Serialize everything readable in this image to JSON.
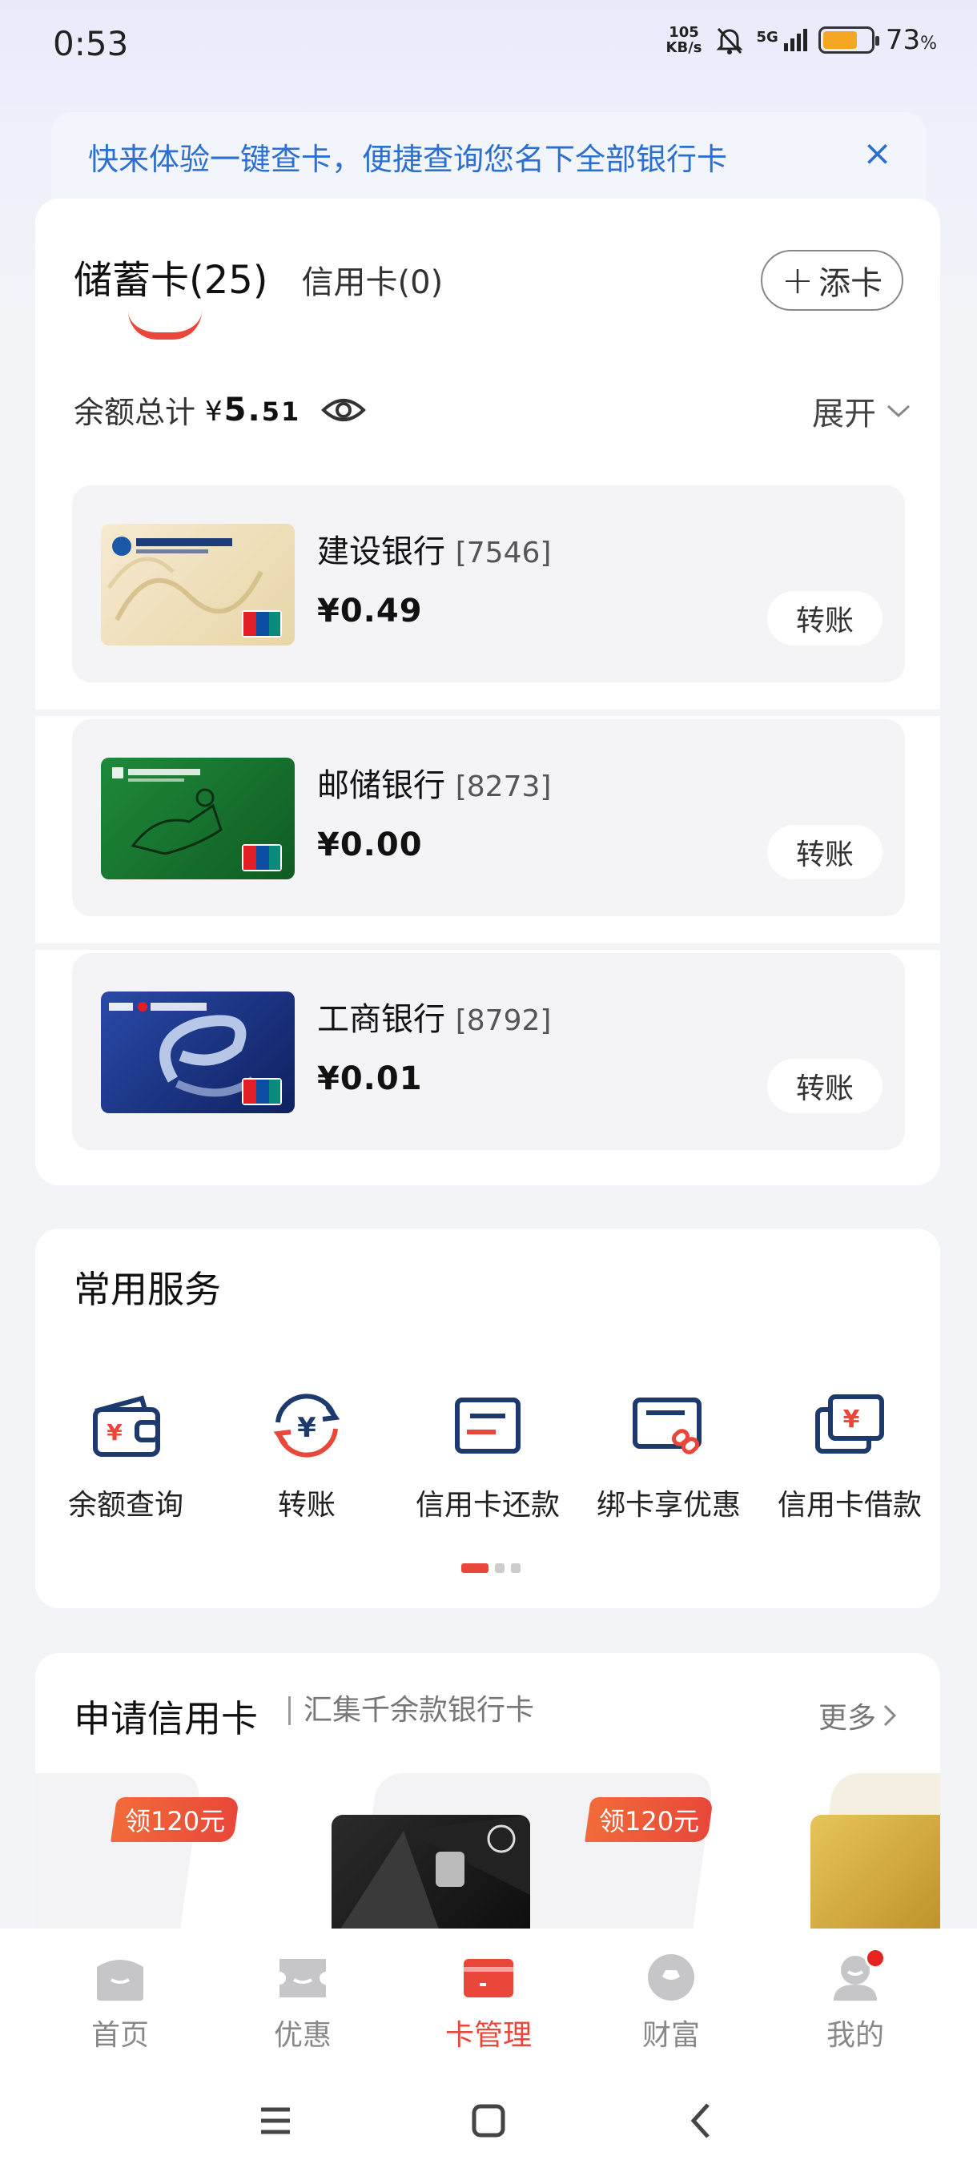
{
  "status_bar": {
    "time": "0:53",
    "net_speed_value": "105",
    "net_speed_unit": "KB/s",
    "network": "5G",
    "battery_percent": "73",
    "battery_unit": "%",
    "battery_level": 0.73
  },
  "banner": {
    "text": "快来体验一键查卡，便捷查询您名下全部银行卡",
    "close_icon": "×"
  },
  "card_tabs": {
    "debit_label": "储蓄卡(25)",
    "credit_label": "信用卡(0)",
    "add_card_label": "添卡"
  },
  "balance": {
    "label": "余额总计",
    "currency": "¥",
    "amount_int": "5.",
    "amount_dec": "51",
    "expand_label": "展开"
  },
  "cards": [
    {
      "bank": "建设银行",
      "number": "[7546]",
      "balance": "¥0.49",
      "transfer_label": "转账"
    },
    {
      "bank": "邮储银行",
      "number": "[8273]",
      "balance": "¥0.00",
      "transfer_label": "转账"
    },
    {
      "bank": "工商银行",
      "number": "[8792]",
      "balance": "¥0.01",
      "transfer_label": "转账"
    }
  ],
  "services": {
    "title": "常用服务",
    "items": [
      {
        "label": "余额查询",
        "icon": "wallet-icon"
      },
      {
        "label": "转账",
        "icon": "transfer-icon"
      },
      {
        "label": "信用卡还款",
        "icon": "card-repay-icon"
      },
      {
        "label": "绑卡享优惠",
        "icon": "bind-card-icon"
      },
      {
        "label": "信用卡借款",
        "icon": "card-loan-icon"
      }
    ]
  },
  "apply": {
    "title": "申请信用卡",
    "subtitle": "汇集千余款银行卡",
    "more_label": "更多",
    "promo_badges": [
      "领120元",
      "领120元"
    ]
  },
  "bottom_nav": {
    "items": [
      {
        "label": "首页"
      },
      {
        "label": "优惠"
      },
      {
        "label": "卡管理"
      },
      {
        "label": "财富"
      },
      {
        "label": "我的"
      }
    ]
  },
  "colors": {
    "accent": "#e8473a",
    "link_blue": "#2c6fd1",
    "icon_navy": "#1d3a6e"
  }
}
